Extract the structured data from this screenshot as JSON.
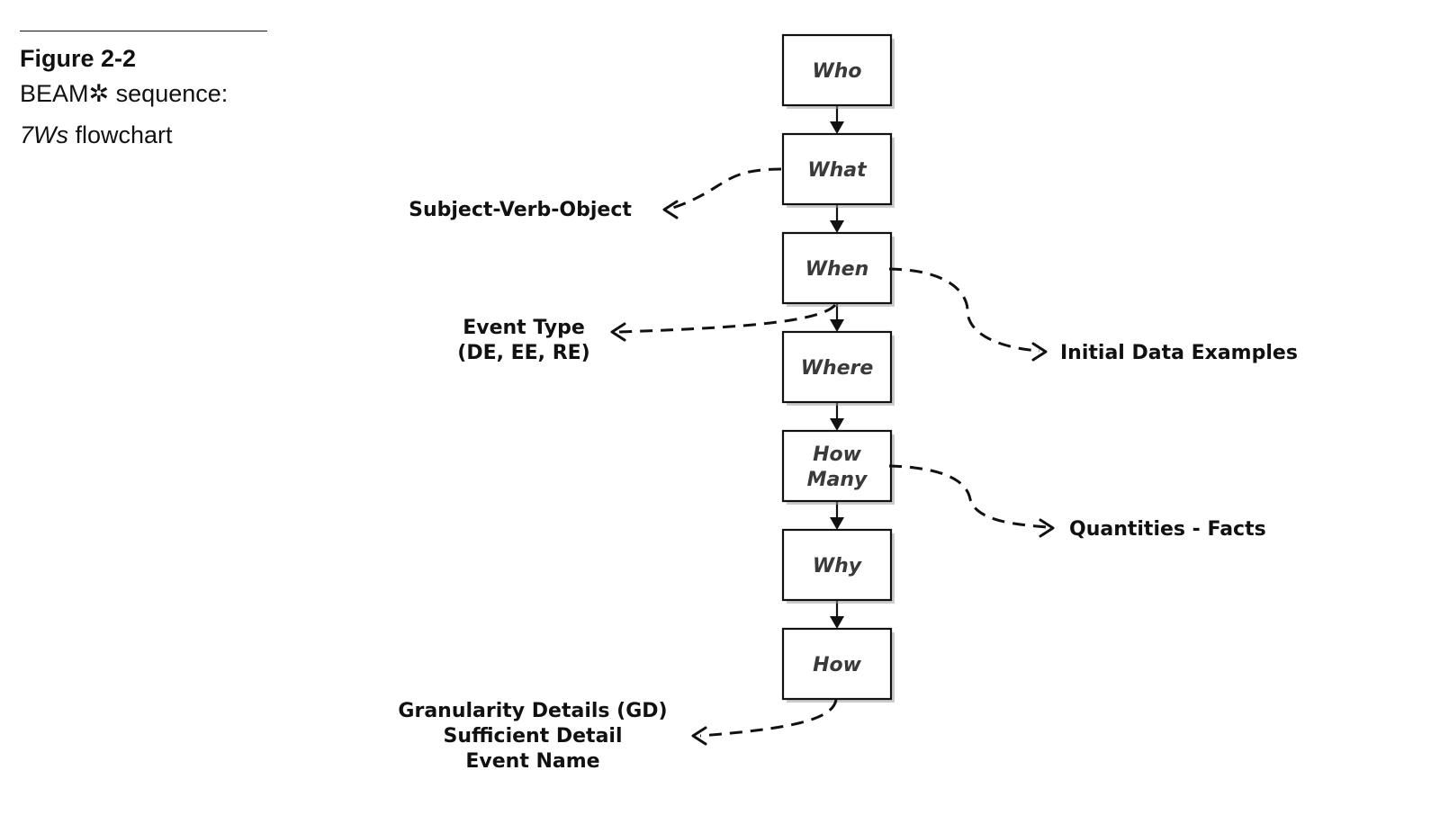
{
  "caption": {
    "title": "Figure 2-2",
    "line1_prefix": "BEAM",
    "line1_symbol": "✲",
    "line1_suffix": " sequence:",
    "line2_italic": "7Ws",
    "line2_rest": " flowchart"
  },
  "flowchart": {
    "steps": [
      {
        "id": "who",
        "lines": [
          "Who"
        ]
      },
      {
        "id": "what",
        "lines": [
          "What"
        ]
      },
      {
        "id": "when",
        "lines": [
          "When"
        ]
      },
      {
        "id": "where",
        "lines": [
          "Where"
        ]
      },
      {
        "id": "how-many",
        "lines": [
          "How",
          "Many"
        ]
      },
      {
        "id": "why",
        "lines": [
          "Why"
        ]
      },
      {
        "id": "how",
        "lines": [
          "How"
        ]
      }
    ],
    "annotations": [
      {
        "id": "subject-verb-object",
        "from": "what",
        "side": "left",
        "lines": [
          "Subject-Verb-Object"
        ]
      },
      {
        "id": "event-type",
        "from": "when",
        "side": "left",
        "lines": [
          "Event Type",
          "(DE, EE, RE)"
        ]
      },
      {
        "id": "initial-data-examples",
        "from": "when",
        "side": "right",
        "lines": [
          "Initial Data Examples"
        ]
      },
      {
        "id": "quantities-facts",
        "from": "how-many",
        "side": "right",
        "lines": [
          "Quantities - Facts"
        ]
      },
      {
        "id": "granularity",
        "from": "how",
        "side": "left",
        "lines": [
          "Granularity Details (GD)",
          "Sufficient Detail",
          "Event Name"
        ]
      }
    ]
  }
}
